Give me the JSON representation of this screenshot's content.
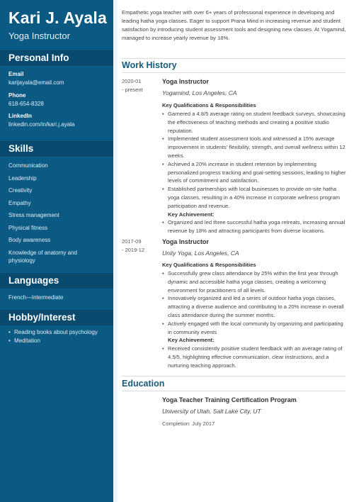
{
  "header": {
    "name": "Kari J. Ayala",
    "title": "Yoga Instructor"
  },
  "sidebar": {
    "personal_info": {
      "heading": "Personal Info",
      "email_label": "Email",
      "email": "karijayala@email.com",
      "phone_label": "Phone",
      "phone": "618-654-8328",
      "linkedin_label": "LinkedIn",
      "linkedin": "linkedin.com/in/kari.j.ayala"
    },
    "skills": {
      "heading": "Skills",
      "items": [
        "Communication",
        "Leadership",
        "Creativity",
        "Empathy",
        "Stress management",
        "Physical fitness",
        "Body awareness",
        "Knowledge of anatomy and physiology"
      ]
    },
    "languages": {
      "heading": "Languages",
      "items": [
        "French—Intermediate"
      ]
    },
    "hobbies": {
      "heading": "Hobby/Interest",
      "items": [
        "Reading books about psychology",
        "Meditation"
      ]
    }
  },
  "main": {
    "summary": "Empathetic yoga teacher with over 6+ years of professional experience in developing and leading hatha yoga classes. Eager to support Prana Mind in increasing revenue and student satisfaction by introducing student assessment tools and designing new classes. At Yogamind, managed to increase yearly revenue by 18%.",
    "work_history": {
      "heading": "Work History",
      "jobs": [
        {
          "date_start": "2020-01",
          "date_end": "- present",
          "title": "Yoga Instructor",
          "company": "Yogamind, Los Angeles, CA",
          "kq_label": "Key Qualifications & Responsibilities",
          "bullets": [
            "Garnered a 4.8/5 average rating on student feedback surveys, showcasing the effectiveness of teaching methods and creating a positive studio reputation.",
            "Implemented student assessment tools and witnessed a 15% average improvement in students' flexibility, strength, and overall wellness within 12 weeks.",
            "Achieved a 20% increase in student retention by implementing personalized progress tracking and goal-setting sessions, leading to higher levels of commitment and satisfaction.",
            "Established partnerships with local businesses to provide on-site hatha yoga classes, resulting in a 40% increase in corporate wellness program participation and revenue."
          ],
          "ka_label": "Key Achievement:",
          "achievements": [
            "Organized and led three successful hatha yoga retreats, increasing annual revenue by 18% and attracting participants from diverse locations."
          ]
        },
        {
          "date_start": "2017-09",
          "date_end": "- 2019-12",
          "title": "Yoga Instructor",
          "company": "Unity Yoga, Los Angeles, CA",
          "kq_label": "Key Qualifications & Responsibilities",
          "bullets": [
            "Successfully grew class attendance by 25% within the first year through dynamic and accessible hatha yoga classes, creating a welcoming environment for practitioners of all levels.",
            "Innovatively organized and led a series of outdoor hatha yoga classes, attracting a diverse audience and contributing to a 20% increase in overall class attendance during the summer months.",
            "Actively engaged with the local community by organizing and participating in community events"
          ],
          "ka_label": "Key Achievement:",
          "achievements": [
            "Received consistently positive student feedback with an average rating of 4.5/5, highlighting effective communication, clear instructions, and a nurturing teaching approach."
          ]
        }
      ]
    },
    "education": {
      "heading": "Education",
      "program": "Yoga Teacher Training Certification Program",
      "school": "University of Utah, Salt Lake City, UT",
      "completion": "Completion: July 2017"
    }
  }
}
